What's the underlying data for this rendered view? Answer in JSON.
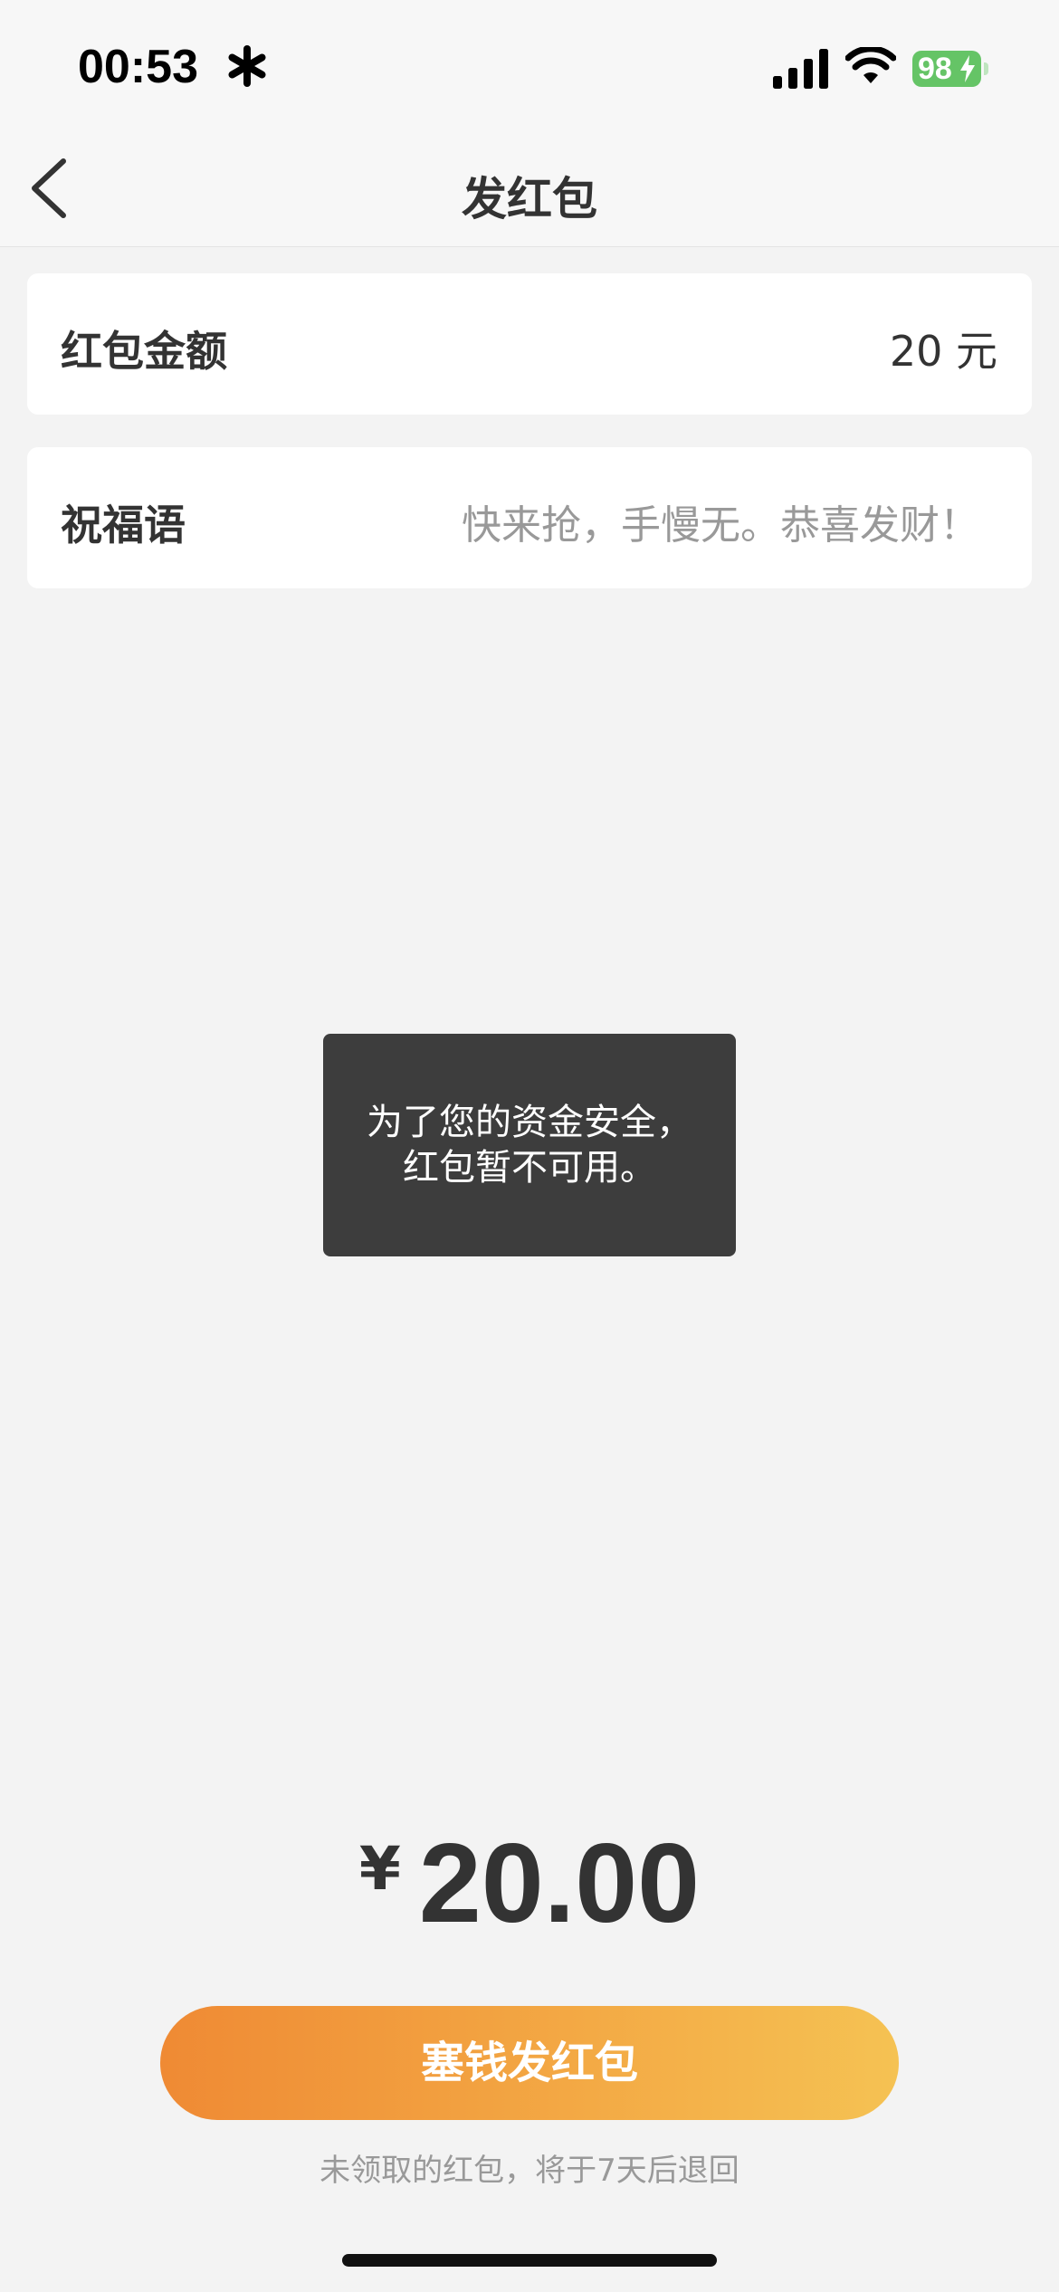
{
  "status_bar": {
    "time": "00:53",
    "battery_level": "98",
    "icons": [
      "asterisk-icon",
      "signal-icon",
      "wifi-icon",
      "battery-icon",
      "charging-bolt-icon"
    ]
  },
  "nav": {
    "title": "发红包",
    "back_icon": "chevron-left-icon"
  },
  "amount_row": {
    "label": "红包金额",
    "value": "20 元"
  },
  "greeting_row": {
    "label": "祝福语",
    "placeholder": "快来抢，手慢无。恭喜发财！"
  },
  "toast": {
    "line1": "为了您的资金安全，",
    "line2": "红包暂不可用。"
  },
  "total": {
    "currency": "¥",
    "value": "20.00"
  },
  "send_button": {
    "label": "塞钱发红包"
  },
  "footnote": "未领取的红包，将于7天后退回",
  "colors": {
    "background": "#f3f3f3",
    "button_gradient_start": "#ef8a34",
    "button_gradient_end": "#f5c253",
    "battery": "#65c466",
    "toast_bg": "#3d3d3d"
  }
}
